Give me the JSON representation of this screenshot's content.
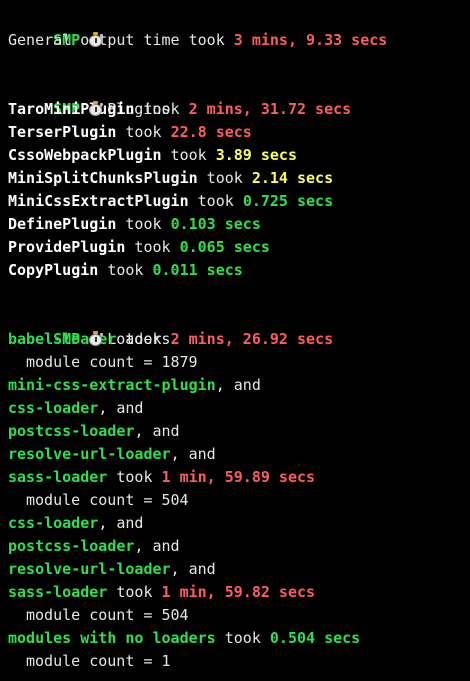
{
  "colors": {
    "background": "#000000",
    "text": "#e6e6e6",
    "green": "#2ee04a",
    "red": "#ff5c5c",
    "yellow": "#ffff55"
  },
  "smp_tag": "SMP",
  "general": {
    "prefix": "General output time took ",
    "time": "3 mins, 9.33 secs"
  },
  "plugins_section": {
    "title": "Plugins",
    "took": " took ",
    "items": [
      {
        "name": "TaroMiniPlugin",
        "time": "2 mins, 31.72 secs",
        "color": "red"
      },
      {
        "name": "TerserPlugin",
        "time": "22.8 secs",
        "color": "red"
      },
      {
        "name": "CssoWebpackPlugin",
        "time": "3.89 secs",
        "color": "yellow"
      },
      {
        "name": "MiniSplitChunksPlugin",
        "time": "2.14 secs",
        "color": "yellow"
      },
      {
        "name": "MiniCssExtractPlugin",
        "time": "0.725 secs",
        "color": "green"
      },
      {
        "name": "DefinePlugin",
        "time": "0.103 secs",
        "color": "green"
      },
      {
        "name": "ProvidePlugin",
        "time": "0.065 secs",
        "color": "green"
      },
      {
        "name": "CopyPlugin",
        "time": "0.011 secs",
        "color": "green"
      }
    ]
  },
  "loaders_section": {
    "title": "Loaders",
    "took": " took ",
    "and": ", and",
    "module_count_prefix": "module count = ",
    "groups": [
      {
        "chain": [
          "babel-loader"
        ],
        "time": "2 mins, 26.92 secs",
        "color": "red",
        "module_count": "1879"
      },
      {
        "chain": [
          "mini-css-extract-plugin",
          "css-loader",
          "postcss-loader",
          "resolve-url-loader",
          "sass-loader"
        ],
        "time": "1 min, 59.89 secs",
        "color": "red",
        "module_count": "504"
      },
      {
        "chain": [
          "css-loader",
          "postcss-loader",
          "resolve-url-loader",
          "sass-loader"
        ],
        "time": "1 min, 59.82 secs",
        "color": "red",
        "module_count": "504"
      },
      {
        "chain": [
          "modules with no loaders"
        ],
        "time": "0.504 secs",
        "color": "green",
        "module_count": "1"
      }
    ]
  }
}
